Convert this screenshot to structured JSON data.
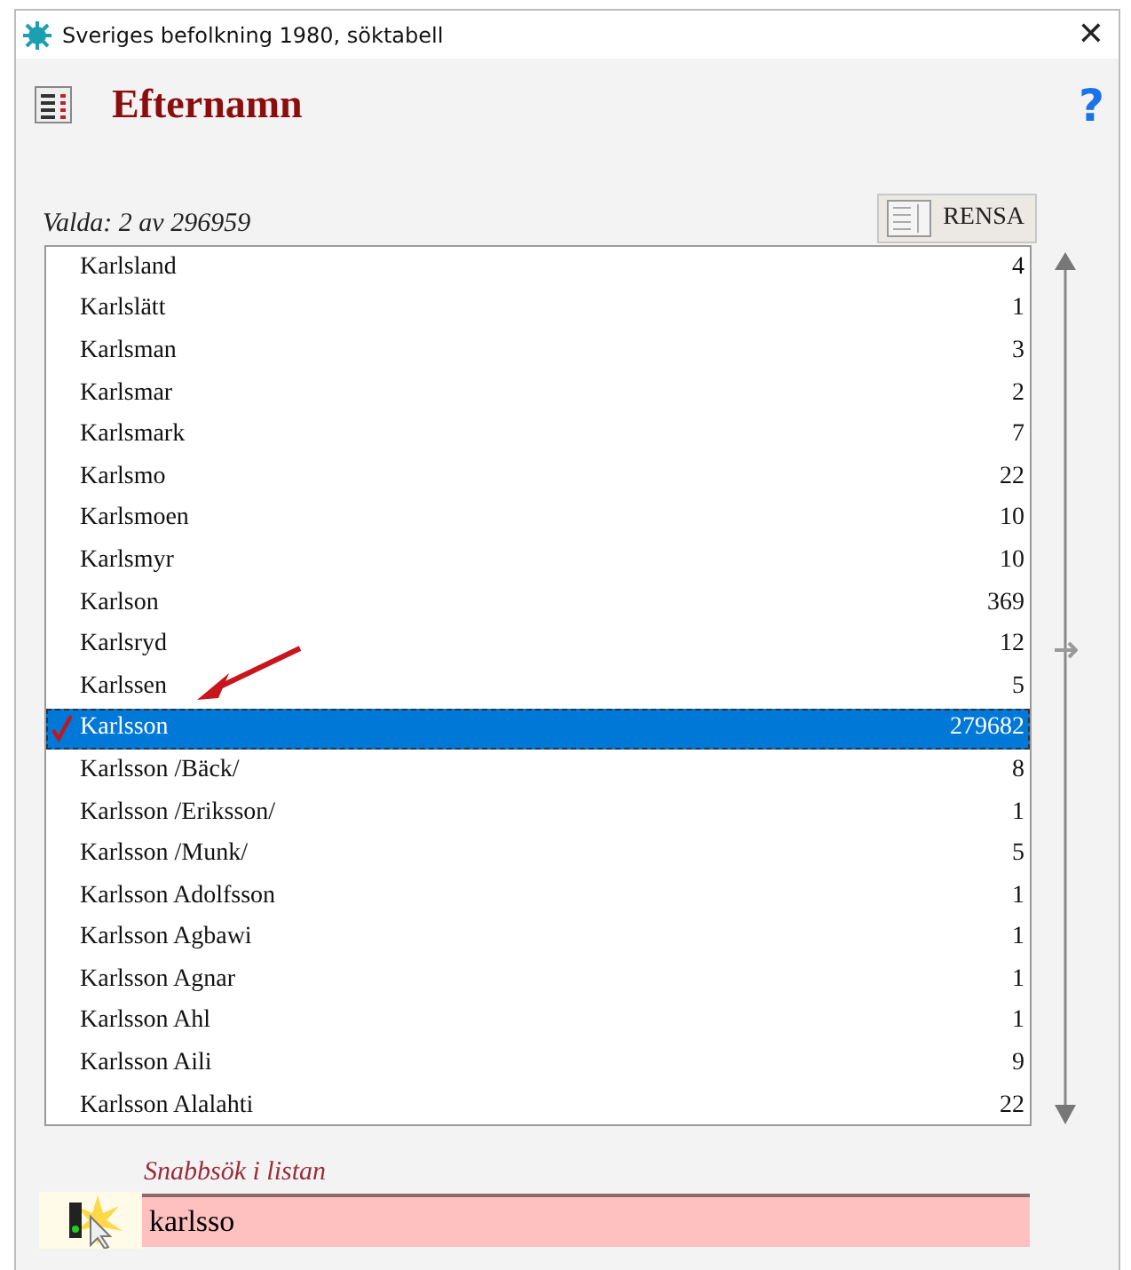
{
  "window": {
    "title": "Sveriges befolkning 1980, söktabell",
    "close": "✕"
  },
  "header": {
    "title": "Efternamn",
    "help": "?"
  },
  "selection_count": "Valda: 2 av 296959",
  "clear_button": {
    "label": "RENSA"
  },
  "list": [
    {
      "name": "Karlsland",
      "count": "4",
      "selected": false,
      "checked": false
    },
    {
      "name": "Karlslätt",
      "count": "1",
      "selected": false,
      "checked": false
    },
    {
      "name": "Karlsman",
      "count": "3",
      "selected": false,
      "checked": false
    },
    {
      "name": "Karlsmar",
      "count": "2",
      "selected": false,
      "checked": false
    },
    {
      "name": "Karlsmark",
      "count": "7",
      "selected": false,
      "checked": false
    },
    {
      "name": "Karlsmo",
      "count": "22",
      "selected": false,
      "checked": false
    },
    {
      "name": "Karlsmoen",
      "count": "10",
      "selected": false,
      "checked": false
    },
    {
      "name": "Karlsmyr",
      "count": "10",
      "selected": false,
      "checked": false
    },
    {
      "name": "Karlson",
      "count": "369",
      "selected": false,
      "checked": false
    },
    {
      "name": "Karlsryd",
      "count": "12",
      "selected": false,
      "checked": false
    },
    {
      "name": "Karlssen",
      "count": "5",
      "selected": false,
      "checked": false
    },
    {
      "name": "Karlsson",
      "count": "279682",
      "selected": true,
      "checked": true
    },
    {
      "name": "Karlsson /Bäck/",
      "count": "8",
      "selected": false,
      "checked": false
    },
    {
      "name": "Karlsson /Eriksson/",
      "count": "1",
      "selected": false,
      "checked": false
    },
    {
      "name": "Karlsson /Munk/",
      "count": "5",
      "selected": false,
      "checked": false
    },
    {
      "name": "Karlsson Adolfsson",
      "count": "1",
      "selected": false,
      "checked": false
    },
    {
      "name": "Karlsson Agbawi",
      "count": "1",
      "selected": false,
      "checked": false
    },
    {
      "name": "Karlsson Agnar",
      "count": "1",
      "selected": false,
      "checked": false
    },
    {
      "name": "Karlsson Ahl",
      "count": "1",
      "selected": false,
      "checked": false
    },
    {
      "name": "Karlsson Aili",
      "count": "9",
      "selected": false,
      "checked": false
    },
    {
      "name": "Karlsson Alalahti",
      "count": "22",
      "selected": false,
      "checked": false
    }
  ],
  "quick_search": {
    "label": "Snabbsök i listan",
    "value": "karlsso"
  }
}
